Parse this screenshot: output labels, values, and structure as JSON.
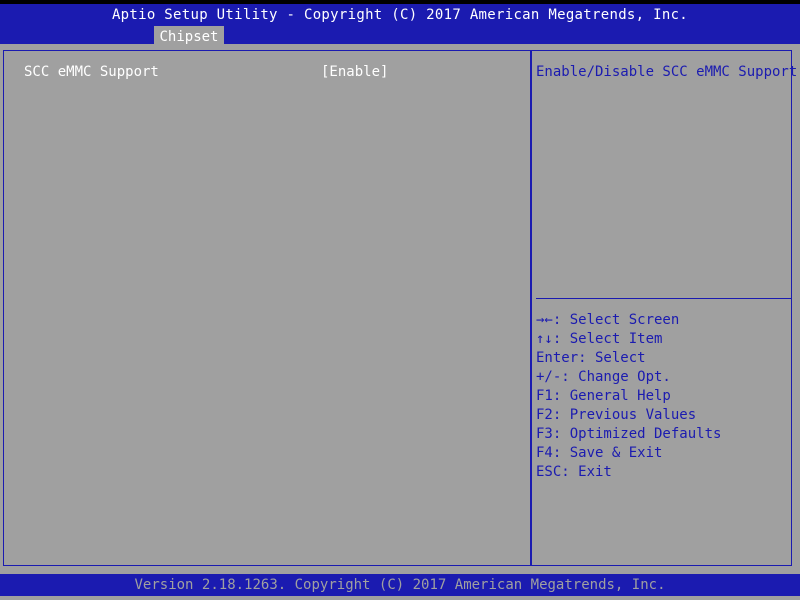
{
  "header": {
    "title": "Aptio Setup Utility - Copyright (C) 2017 American Megatrends, Inc.",
    "tabs": [
      {
        "label": "Chipset"
      }
    ]
  },
  "settings": [
    {
      "label": "SCC eMMC Support",
      "value": "[Enable]"
    }
  ],
  "help_panel": {
    "description": "Enable/Disable SCC eMMC Support",
    "keys": [
      "→←: Select Screen",
      "↑↓: Select Item",
      "Enter: Select",
      "+/-: Change Opt.",
      "F1: General Help",
      "F2: Previous Values",
      "F3: Optimized Defaults",
      "F4: Save & Exit",
      "ESC: Exit"
    ]
  },
  "footer": {
    "version": "Version 2.18.1263. Copyright (C) 2017 American Megatrends, Inc."
  },
  "colors": {
    "accent": "#1b1bb0",
    "background": "#a0a0a0",
    "text_highlight": "#ffffff"
  }
}
